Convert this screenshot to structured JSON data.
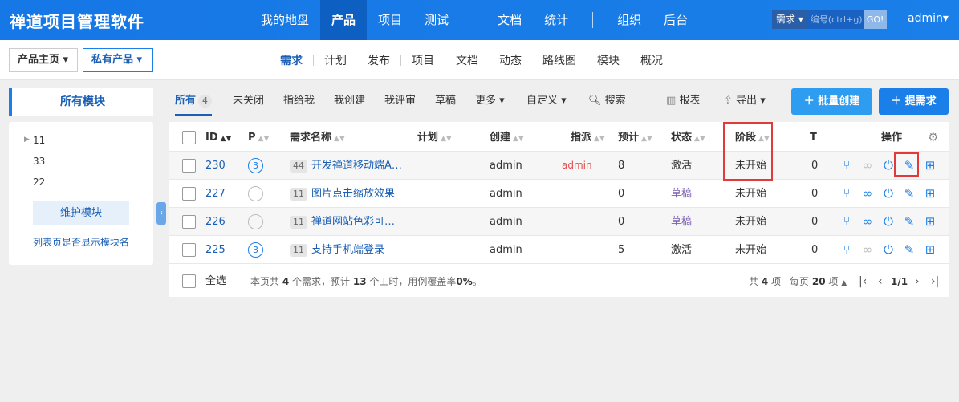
{
  "app": {
    "title": "禅道项目管理软件"
  },
  "top_nav": {
    "items": [
      "我的地盘",
      "产品",
      "项目",
      "测试",
      "文档",
      "统计",
      "组织",
      "后台"
    ],
    "active": "产品"
  },
  "search": {
    "type": "需求",
    "placeholder": "编号(ctrl+g)",
    "go": "GO!"
  },
  "user": {
    "name": "admin"
  },
  "breadcrumb": {
    "home": "产品主页",
    "product": "私有产品"
  },
  "sub_nav": {
    "items": [
      "需求",
      "计划",
      "发布",
      "项目",
      "文档",
      "动态",
      "路线图",
      "模块",
      "概况"
    ],
    "active": "需求"
  },
  "sidebar": {
    "title": "所有模块",
    "modules": [
      "11",
      "33",
      "22"
    ],
    "maintain": "维护模块",
    "show_link": "列表页是否显示模块名"
  },
  "toolbar": {
    "all": "所有",
    "all_count": "4",
    "unclosed": "未关闭",
    "assigned": "指给我",
    "created": "我创建",
    "review": "我评审",
    "draft": "草稿",
    "more": "更多",
    "custom": "自定义",
    "search": "搜索",
    "report": "报表",
    "export": "导出",
    "batch_create": "批量创建",
    "create": "提需求"
  },
  "table": {
    "headers": {
      "id": "ID",
      "pri": "P",
      "title": "需求名称",
      "plan": "计划",
      "creator": "创建",
      "assignee": "指派",
      "estimate": "预计",
      "status": "状态",
      "stage": "阶段",
      "task": "T",
      "actions": "操作"
    },
    "rows": [
      {
        "id": "230",
        "pri": "3",
        "module": "44",
        "title": "开发禅道移动端A…",
        "creator": "admin",
        "assignee": "admin",
        "estimate": "8",
        "status": "激活",
        "stage": "未开始",
        "task": "0"
      },
      {
        "id": "227",
        "pri": "",
        "module": "11",
        "title": "图片点击缩放效果",
        "creator": "admin",
        "assignee": "",
        "estimate": "0",
        "status": "草稿",
        "stage": "未开始",
        "task": "0"
      },
      {
        "id": "226",
        "pri": "",
        "module": "11",
        "title": "禅道网站色彩可…",
        "creator": "admin",
        "assignee": "",
        "estimate": "0",
        "status": "草稿",
        "stage": "未开始",
        "task": "0"
      },
      {
        "id": "225",
        "pri": "3",
        "module": "11",
        "title": "支持手机端登录",
        "creator": "admin",
        "assignee": "",
        "estimate": "5",
        "status": "激活",
        "stage": "未开始",
        "task": "0"
      }
    ],
    "footer": {
      "select_all": "全选",
      "summary_prefix": "本页共",
      "summary_count": "4",
      "summary_mid": "个需求，预计",
      "summary_hours": "13",
      "summary_mid2": "个工时，用例覆盖率",
      "summary_rate": "0%",
      "summary_end": "。",
      "total_prefix": "共",
      "total": "4",
      "total_unit": "项",
      "per_page_prefix": "每页",
      "per_page": "20",
      "per_page_unit": "项",
      "page": "1/1"
    }
  },
  "colors": {
    "accent": "#1a7fe8",
    "highlight": "#e03a3a"
  }
}
